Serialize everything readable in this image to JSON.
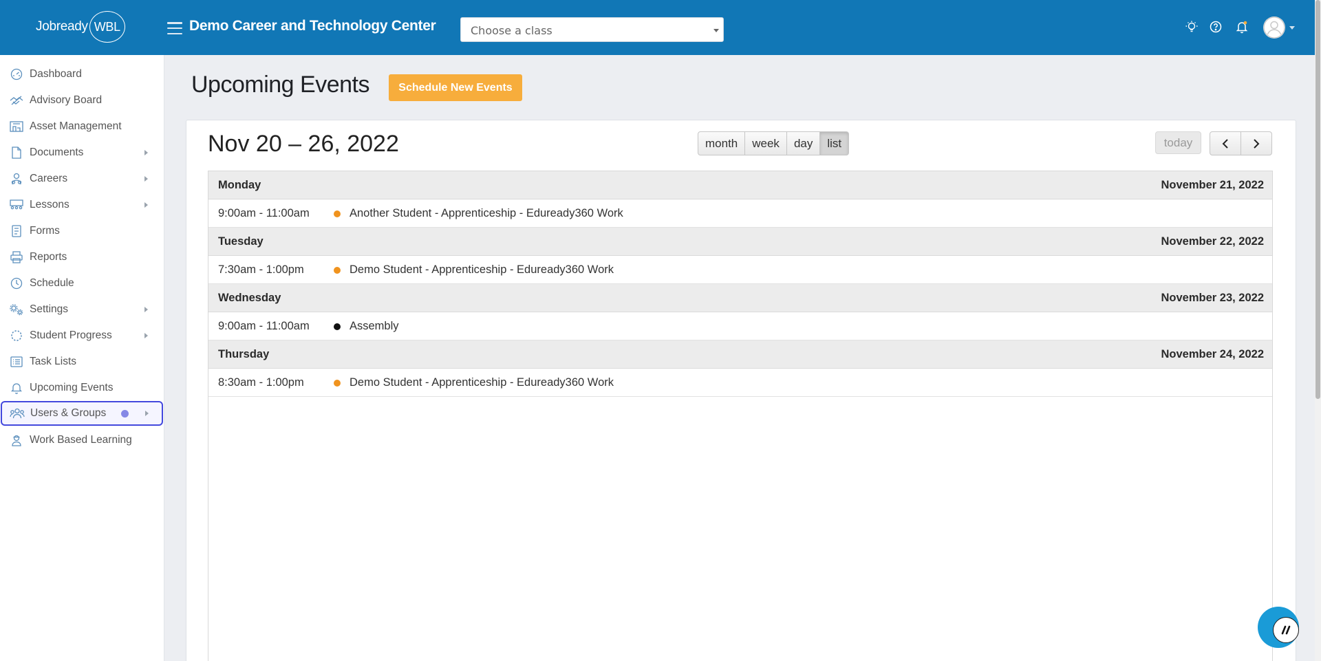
{
  "app": {
    "logo_text": "Jobready",
    "logo_badge": "WBL",
    "org_title": "Demo Career and Technology Center"
  },
  "header": {
    "class_select_placeholder": "Choose a class",
    "icons": [
      "lightbulb-icon",
      "help-icon",
      "bell-icon",
      "avatar-icon"
    ]
  },
  "sidebar": {
    "items": [
      {
        "label": "Dashboard",
        "icon": "speedometer-icon",
        "has_submenu": false
      },
      {
        "label": "Advisory Board",
        "icon": "handshake-icon",
        "has_submenu": false
      },
      {
        "label": "Asset Management",
        "icon": "warehouse-icon",
        "has_submenu": false
      },
      {
        "label": "Documents",
        "icon": "document-icon",
        "has_submenu": true
      },
      {
        "label": "Careers",
        "icon": "career-person-icon",
        "has_submenu": true
      },
      {
        "label": "Lessons",
        "icon": "classroom-icon",
        "has_submenu": true
      },
      {
        "label": "Forms",
        "icon": "form-icon",
        "has_submenu": false
      },
      {
        "label": "Reports",
        "icon": "printer-icon",
        "has_submenu": false
      },
      {
        "label": "Schedule",
        "icon": "clock-icon",
        "has_submenu": false
      },
      {
        "label": "Settings",
        "icon": "gears-icon",
        "has_submenu": true
      },
      {
        "label": "Student Progress",
        "icon": "progress-circle-icon",
        "has_submenu": true
      },
      {
        "label": "Task Lists",
        "icon": "list-icon",
        "has_submenu": false
      },
      {
        "label": "Upcoming Events",
        "icon": "bell-icon",
        "has_submenu": false
      },
      {
        "label": "Users & Groups",
        "icon": "users-icon",
        "has_submenu": true,
        "focused": true
      },
      {
        "label": "Work Based Learning",
        "icon": "worker-icon",
        "has_submenu": false
      }
    ]
  },
  "main": {
    "page_title": "Upcoming Events",
    "schedule_button": "Schedule New Events",
    "calendar": {
      "range_title": "Nov 20 – 26, 2022",
      "views": [
        "month",
        "week",
        "day",
        "list"
      ],
      "active_view": "list",
      "today_label": "today",
      "days": [
        {
          "name": "Monday",
          "date": "November 21, 2022",
          "events": [
            {
              "time": "9:00am - 11:00am",
              "title": "Another Student - Apprenticeship - Eduready360 Work",
              "color": "#f0931e"
            }
          ]
        },
        {
          "name": "Tuesday",
          "date": "November 22, 2022",
          "events": [
            {
              "time": "7:30am - 1:00pm",
              "title": "Demo Student - Apprenticeship - Eduready360 Work",
              "color": "#f0931e"
            }
          ]
        },
        {
          "name": "Wednesday",
          "date": "November 23, 2022",
          "events": [
            {
              "time": "9:00am - 11:00am",
              "title": "Assembly",
              "color": "#111111"
            }
          ]
        },
        {
          "name": "Thursday",
          "date": "November 24, 2022",
          "events": [
            {
              "time": "8:30am - 1:00pm",
              "title": "Demo Student - Apprenticeship - Eduready360 Work",
              "color": "#f0931e"
            }
          ]
        }
      ]
    }
  },
  "colors": {
    "header_bg": "#1177b6",
    "accent_orange": "#f7ad3c",
    "focus_ring": "#4348dd",
    "chat_blue": "#1a9bd7"
  }
}
